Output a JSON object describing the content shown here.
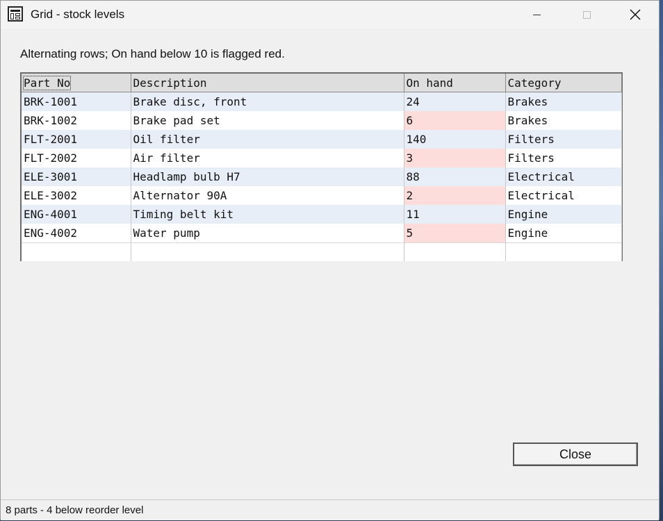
{
  "window": {
    "title": "Grid - stock levels",
    "icon": "grid-window-icon",
    "controls": [
      "minimize-icon",
      "maximize-icon",
      "close-icon"
    ]
  },
  "hint": "Alternating rows; On hand below 10 is flagged red.",
  "grid": {
    "columns": [
      "Part No",
      "Description",
      "On hand",
      "Category"
    ],
    "rows": [
      {
        "part": "BRK-1001",
        "desc": "Brake disc, front",
        "onhand": "24",
        "cat": "Brakes",
        "low": false
      },
      {
        "part": "BRK-1002",
        "desc": "Brake pad set",
        "onhand": "6",
        "cat": "Brakes",
        "low": true
      },
      {
        "part": "FLT-2001",
        "desc": "Oil filter",
        "onhand": "140",
        "cat": "Filters",
        "low": false
      },
      {
        "part": "FLT-2002",
        "desc": "Air filter",
        "onhand": "3",
        "cat": "Filters",
        "low": true
      },
      {
        "part": "ELE-3001",
        "desc": "Headlamp bulb H7",
        "onhand": "88",
        "cat": "Electrical",
        "low": false
      },
      {
        "part": "ELE-3002",
        "desc": "Alternator 90A",
        "onhand": "2",
        "cat": "Electrical",
        "low": true
      },
      {
        "part": "ENG-4001",
        "desc": "Timing belt kit",
        "onhand": "11",
        "cat": "Engine",
        "low": false
      },
      {
        "part": "ENG-4002",
        "desc": "Water pump",
        "onhand": "5",
        "cat": "Engine",
        "low": true
      }
    ],
    "colors": {
      "alt_row": "#e8eef8",
      "low_stock": "#fddcdc"
    }
  },
  "buttons": {
    "close_label": "Close"
  },
  "status": "8 parts - 4 below reorder level"
}
